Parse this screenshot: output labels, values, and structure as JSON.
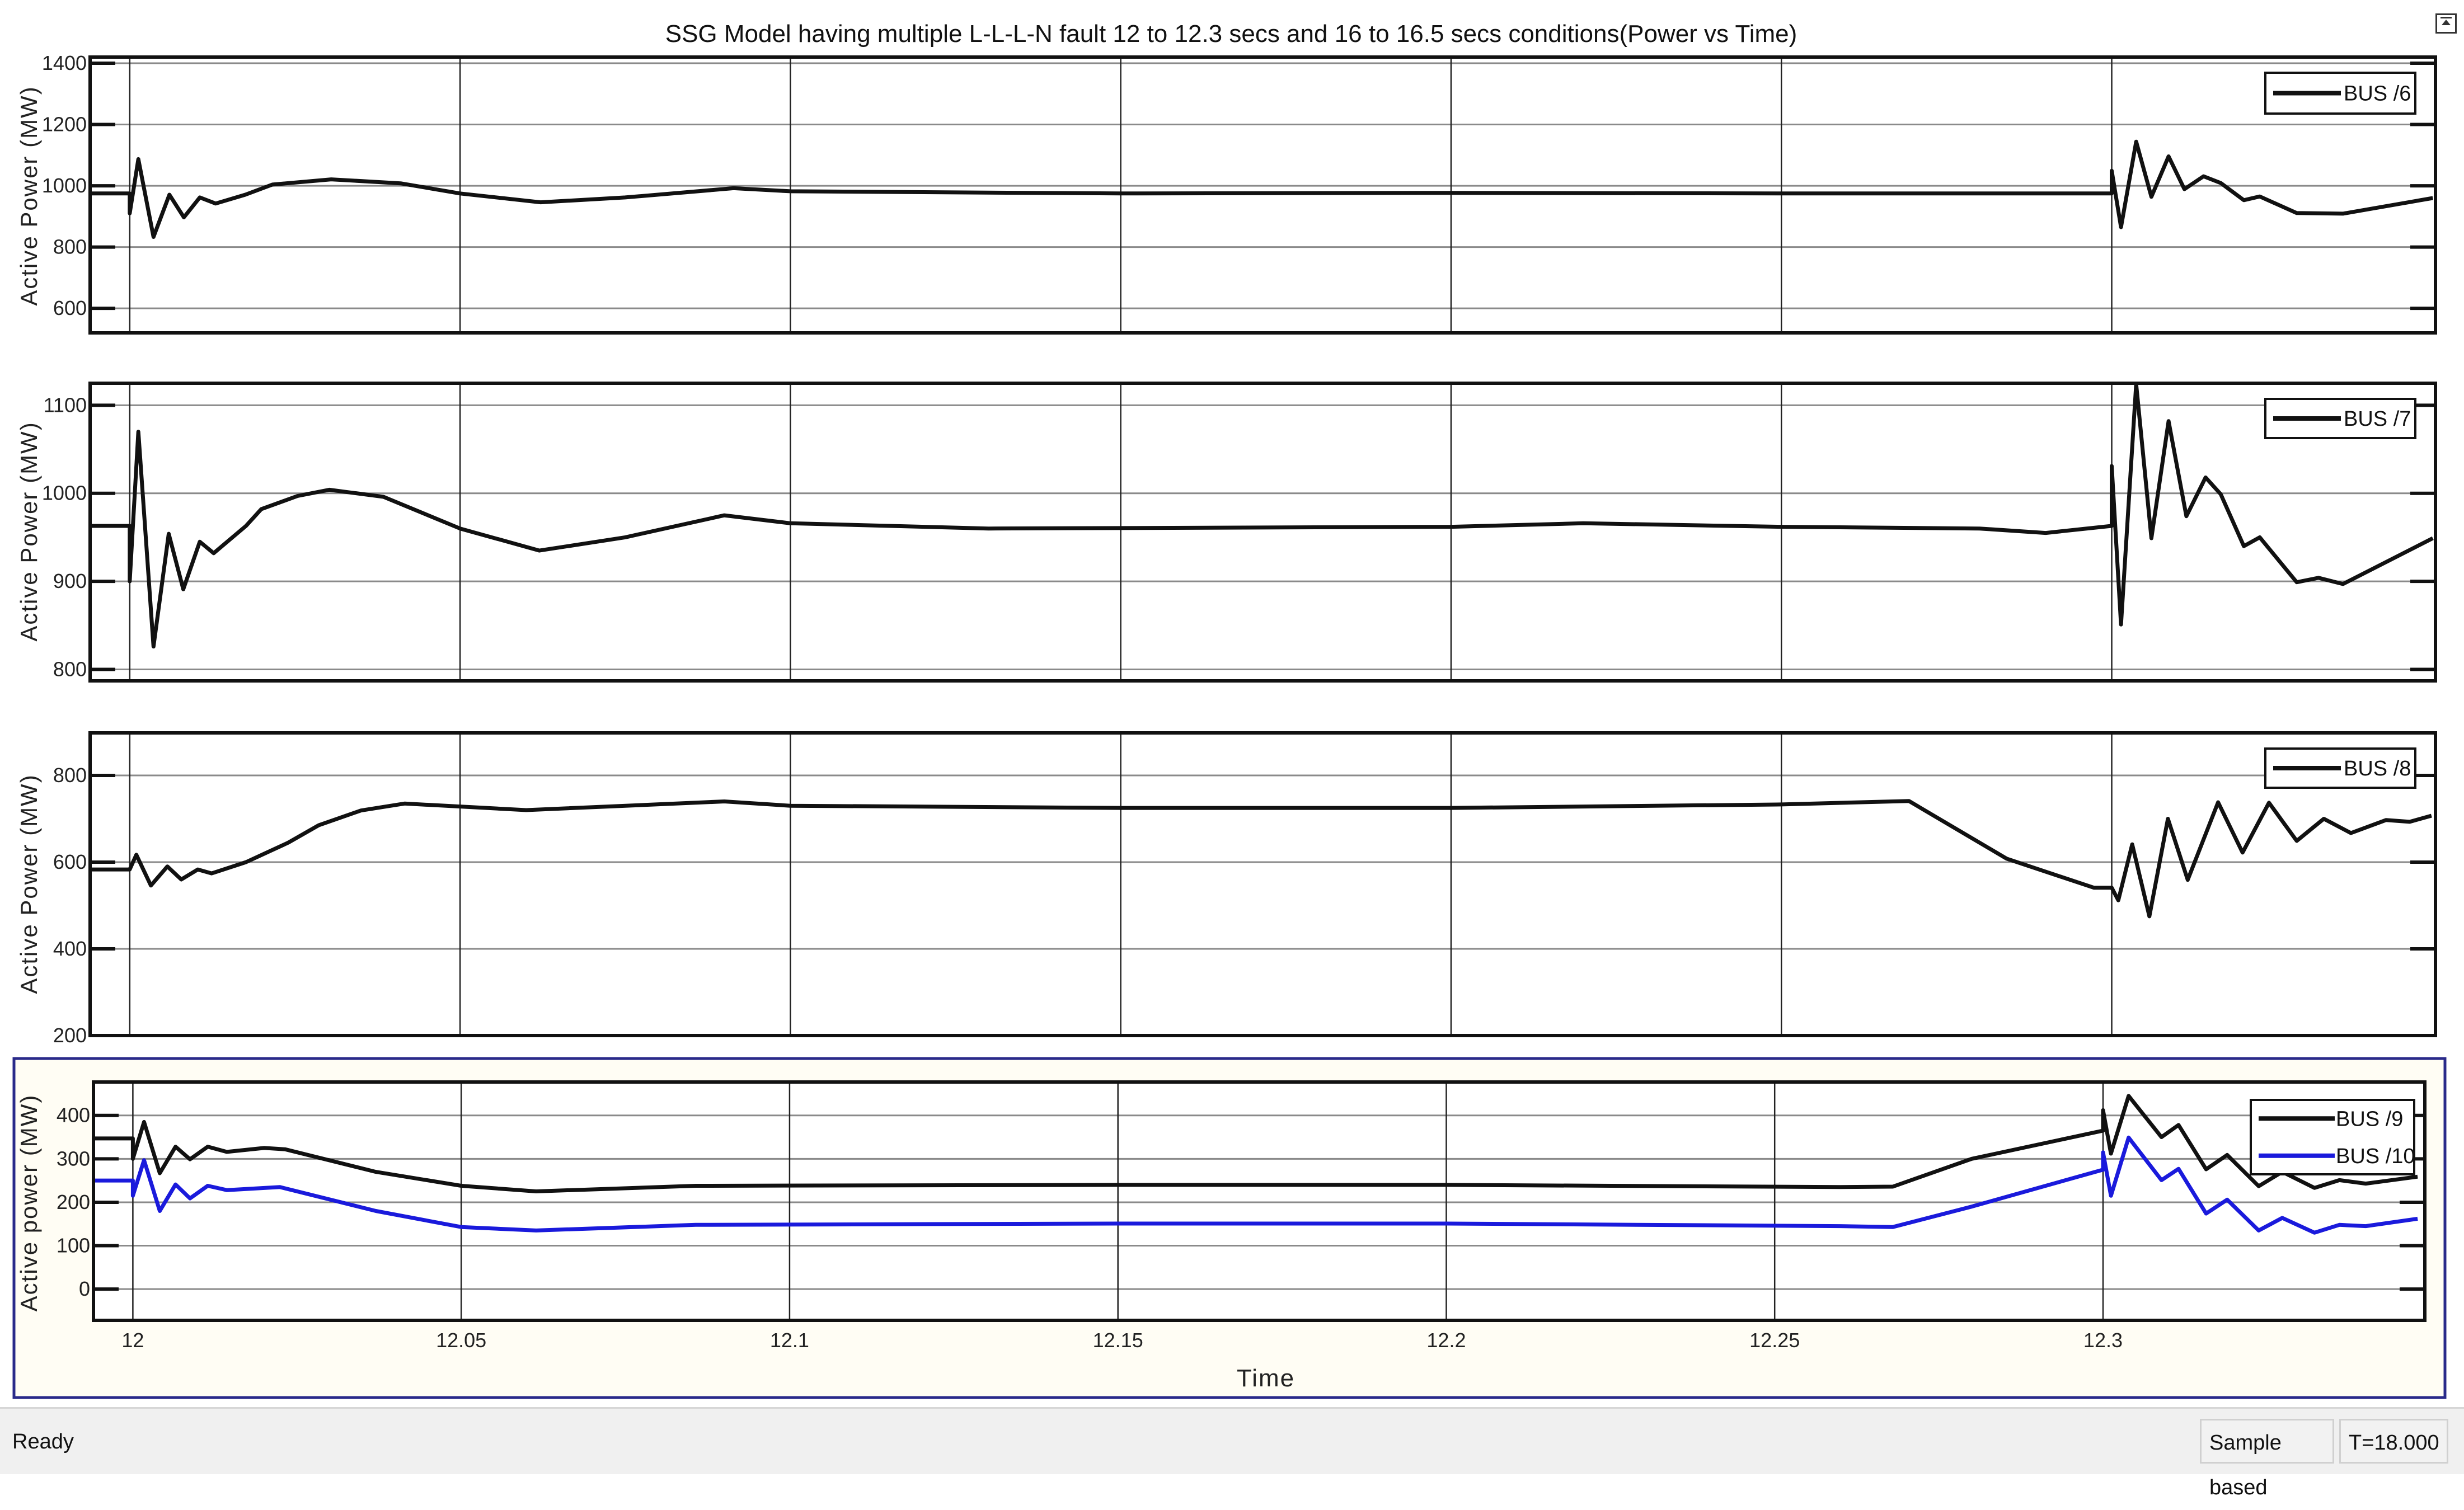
{
  "figure": {
    "title": "SSG Model having multiple L-L-L-N fault 12 to 12.3 secs and 16 to 16.5 secs conditions(Power vs Time)",
    "xlabel": "Time",
    "xlim": [
      11.994,
      12.349
    ],
    "xticks": [
      12,
      12.05,
      12.1,
      12.15,
      12.2,
      12.25,
      12.3
    ],
    "xtick_labels": [
      "12",
      "12.05",
      "12.1",
      "12.15",
      "12.2",
      "12.25",
      "12.3"
    ],
    "grid": true
  },
  "window": {
    "status": "Ready",
    "sample_mode": "Sample based",
    "time_readout": "T=18.000",
    "restore_icon": "restore-axes-icon"
  },
  "chart_data": [
    {
      "type": "line",
      "ylabel": "Active Power (MW)",
      "ylim": [
        520,
        1420
      ],
      "yticks": [
        600,
        800,
        1000,
        1200,
        1400
      ],
      "ytick_labels": [
        "600",
        "800",
        "1000",
        "1200",
        "1400"
      ],
      "legend": "top-right",
      "series": [
        {
          "name": "BUS /6",
          "color": "#111111",
          "points": [
            [
              11.994,
              975
            ],
            [
              12.0,
              975
            ],
            [
              12.0,
              910
            ],
            [
              12.0013,
              1087
            ],
            [
              12.0036,
              833
            ],
            [
              12.006,
              971
            ],
            [
              12.0082,
              897
            ],
            [
              12.0106,
              962
            ],
            [
              12.013,
              942
            ],
            [
              12.0175,
              971
            ],
            [
              12.0216,
              1004
            ],
            [
              12.0305,
              1021
            ],
            [
              12.041,
              1008
            ],
            [
              12.05,
              975
            ],
            [
              12.0622,
              946
            ],
            [
              12.075,
              962
            ],
            [
              12.0914,
              992
            ],
            [
              12.1,
              982
            ],
            [
              12.15,
              975
            ],
            [
              12.2,
              977
            ],
            [
              12.25,
              975
            ],
            [
              12.3,
              975
            ],
            [
              12.3,
              1049
            ],
            [
              12.3014,
              865
            ],
            [
              12.3037,
              1144
            ],
            [
              12.306,
              964
            ],
            [
              12.3086,
              1096
            ],
            [
              12.311,
              989
            ],
            [
              12.3139,
              1031
            ],
            [
              12.3165,
              1009
            ],
            [
              12.32,
              953
            ],
            [
              12.3224,
              965
            ],
            [
              12.328,
              911
            ],
            [
              12.335,
              909
            ],
            [
              12.3486,
              960
            ]
          ]
        }
      ]
    },
    {
      "type": "line",
      "ylabel": "Active Power (MW)",
      "ylim": [
        787,
        1125
      ],
      "yticks": [
        800,
        900,
        1000,
        1100
      ],
      "ytick_labels": [
        "800",
        "900",
        "1000",
        "1100"
      ],
      "legend": "top-right",
      "series": [
        {
          "name": "BUS /7",
          "color": "#111111",
          "points": [
            [
              11.994,
              963
            ],
            [
              12.0,
              963
            ],
            [
              12.0,
              900
            ],
            [
              12.0013,
              1070
            ],
            [
              12.0036,
              826
            ],
            [
              12.0059,
              954
            ],
            [
              12.0081,
              891
            ],
            [
              12.0106,
              945
            ],
            [
              12.0127,
              932
            ],
            [
              12.0176,
              963
            ],
            [
              12.0199,
              982
            ],
            [
              12.0254,
              997
            ],
            [
              12.0302,
              1004
            ],
            [
              12.0384,
              996
            ],
            [
              12.05,
              960
            ],
            [
              12.062,
              935
            ],
            [
              12.075,
              950
            ],
            [
              12.09,
              975
            ],
            [
              12.1,
              966
            ],
            [
              12.13,
              960
            ],
            [
              12.2,
              962
            ],
            [
              12.22,
              966
            ],
            [
              12.25,
              962
            ],
            [
              12.28,
              960
            ],
            [
              12.29,
              955
            ],
            [
              12.3,
              963
            ],
            [
              12.3,
              1031
            ],
            [
              12.3014,
              851
            ],
            [
              12.3037,
              1124
            ],
            [
              12.306,
              949
            ],
            [
              12.3086,
              1082
            ],
            [
              12.3113,
              974
            ],
            [
              12.3142,
              1018
            ],
            [
              12.3165,
              999
            ],
            [
              12.32,
              940
            ],
            [
              12.3224,
              950
            ],
            [
              12.328,
              899
            ],
            [
              12.3313,
              904
            ],
            [
              12.335,
              897
            ],
            [
              12.3486,
              949
            ]
          ]
        }
      ]
    },
    {
      "type": "line",
      "ylabel": "Active Power (MW)",
      "ylim": [
        200,
        898
      ],
      "yticks": [
        200,
        400,
        600,
        800
      ],
      "ytick_labels": [
        "200",
        "400",
        "600",
        "800"
      ],
      "legend": "top-right",
      "series": [
        {
          "name": "BUS /8",
          "color": "#111111",
          "points": [
            [
              11.994,
              583
            ],
            [
              12.0,
              583
            ],
            [
              12.001,
              617
            ],
            [
              12.0032,
              546
            ],
            [
              12.0057,
              590
            ],
            [
              12.0078,
              560
            ],
            [
              12.0103,
              583
            ],
            [
              12.0124,
              574
            ],
            [
              12.0176,
              600
            ],
            [
              12.024,
              645
            ],
            [
              12.0286,
              685
            ],
            [
              12.035,
              719
            ],
            [
              12.0416,
              735
            ],
            [
              12.06,
              720
            ],
            [
              12.09,
              740
            ],
            [
              12.1,
              730
            ],
            [
              12.15,
              725
            ],
            [
              12.2,
              725
            ],
            [
              12.25,
              733
            ],
            [
              12.2693,
              741
            ],
            [
              12.2841,
              608
            ],
            [
              12.2973,
              541
            ],
            [
              12.3,
              541
            ],
            [
              12.301,
              512
            ],
            [
              12.3031,
              641
            ],
            [
              12.3057,
              475
            ],
            [
              12.3085,
              700
            ],
            [
              12.3115,
              559
            ],
            [
              12.3161,
              738
            ],
            [
              12.3198,
              622
            ],
            [
              12.3238,
              737
            ],
            [
              12.328,
              649
            ],
            [
              12.3321,
              700
            ],
            [
              12.3362,
              667
            ],
            [
              12.3415,
              697
            ],
            [
              12.3451,
              693
            ],
            [
              12.3484,
              707
            ]
          ]
        }
      ]
    },
    {
      "type": "line",
      "ylabel": "Active power (MW)",
      "ylim": [
        -72,
        477
      ],
      "yticks": [
        0,
        100,
        200,
        300,
        400
      ],
      "ytick_labels": [
        "0",
        "100",
        "200",
        "300",
        "400"
      ],
      "legend": "top-right",
      "series": [
        {
          "name": "BUS /9",
          "color": "#111111",
          "points": [
            [
              11.994,
              347
            ],
            [
              12.0,
              347
            ],
            [
              12.0,
              300
            ],
            [
              12.0017,
              385
            ],
            [
              12.0041,
              267
            ],
            [
              12.0065,
              328
            ],
            [
              12.0087,
              299
            ],
            [
              12.0114,
              328
            ],
            [
              12.0143,
              316
            ],
            [
              12.02,
              325
            ],
            [
              12.0232,
              322
            ],
            [
              12.037,
              270
            ],
            [
              12.05,
              238
            ],
            [
              12.0614,
              225
            ],
            [
              12.0857,
              238
            ],
            [
              12.15,
              240
            ],
            [
              12.2,
              240
            ],
            [
              12.26,
              235
            ],
            [
              12.268,
              236
            ],
            [
              12.28,
              300
            ],
            [
              12.3,
              365
            ],
            [
              12.3,
              412
            ],
            [
              12.3012,
              312
            ],
            [
              12.3039,
              445
            ],
            [
              12.3089,
              350
            ],
            [
              12.3115,
              378
            ],
            [
              12.3157,
              276
            ],
            [
              12.3189,
              309
            ],
            [
              12.3237,
              237
            ],
            [
              12.3273,
              270
            ],
            [
              12.3322,
              233
            ],
            [
              12.336,
              251
            ],
            [
              12.34,
              243
            ],
            [
              12.3479,
              259
            ]
          ]
        },
        {
          "name": "BUS /10",
          "color": "#1a1adc",
          "points": [
            [
              11.994,
              250
            ],
            [
              12.0,
              250
            ],
            [
              12.0,
              215
            ],
            [
              12.0017,
              297
            ],
            [
              12.0041,
              180
            ],
            [
              12.0065,
              241
            ],
            [
              12.0087,
              209
            ],
            [
              12.0114,
              238
            ],
            [
              12.0143,
              228
            ],
            [
              12.0224,
              235
            ],
            [
              12.037,
              180
            ],
            [
              12.05,
              143
            ],
            [
              12.0614,
              135
            ],
            [
              12.0857,
              148
            ],
            [
              12.15,
              151
            ],
            [
              12.2,
              151
            ],
            [
              12.26,
              145
            ],
            [
              12.268,
              143
            ],
            [
              12.28,
              190
            ],
            [
              12.3,
              275
            ],
            [
              12.3,
              315
            ],
            [
              12.3012,
              215
            ],
            [
              12.3039,
              349
            ],
            [
              12.3089,
              251
            ],
            [
              12.3115,
              277
            ],
            [
              12.3157,
              174
            ],
            [
              12.3189,
              206
            ],
            [
              12.3237,
              135
            ],
            [
              12.3273,
              164
            ],
            [
              12.3322,
              130
            ],
            [
              12.336,
              148
            ],
            [
              12.34,
              145
            ],
            [
              12.3479,
              162
            ]
          ]
        }
      ]
    }
  ]
}
